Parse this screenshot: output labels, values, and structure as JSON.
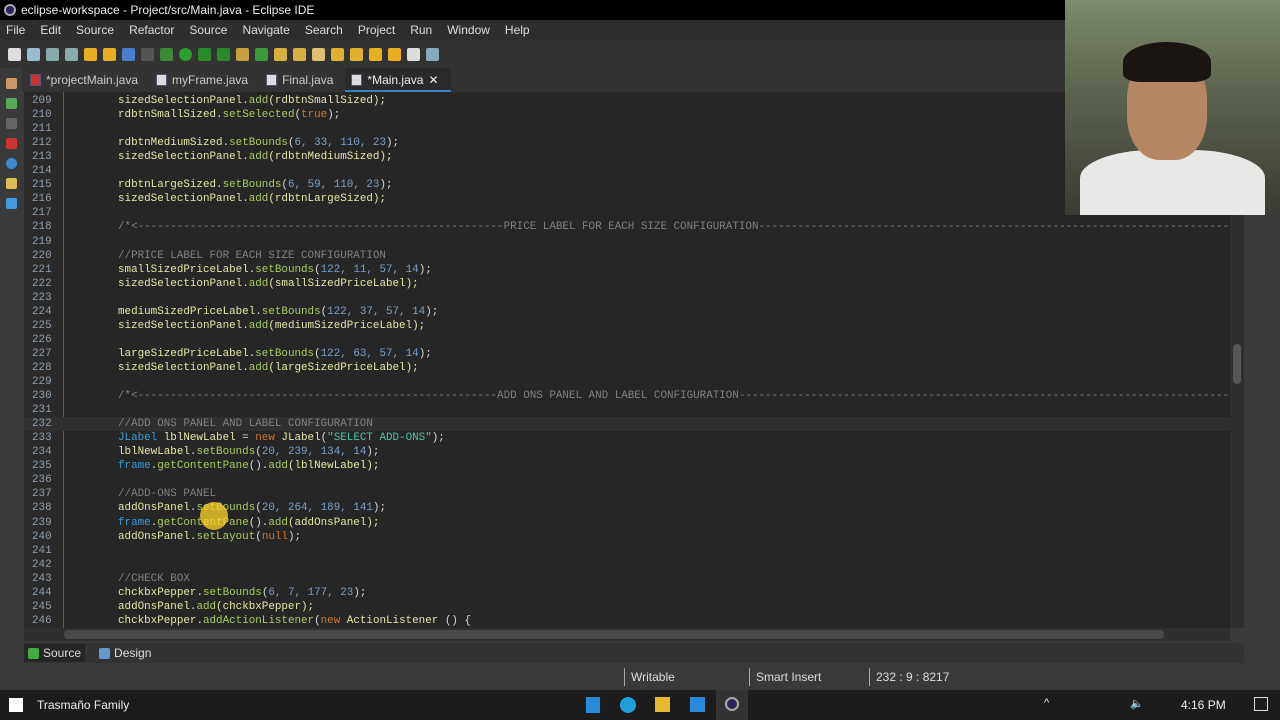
{
  "window": {
    "title": "eclipse-workspace - Project/src/Main.java - Eclipse IDE"
  },
  "menu": [
    "File",
    "Edit",
    "Source",
    "Refactor",
    "Source",
    "Navigate",
    "Search",
    "Project",
    "Run",
    "Window",
    "Help"
  ],
  "tabs": [
    {
      "label": "*projectMain.java"
    },
    {
      "label": "myFrame.java"
    },
    {
      "label": "Final.java"
    },
    {
      "label": "*Main.java",
      "close": "✕"
    }
  ],
  "editor": {
    "current_line": 232,
    "lines": [
      {
        "n": "209",
        "t": [
          [
            "sizedSelectionPanel",
            "id"
          ],
          [
            ".",
            "p"
          ],
          [
            "add",
            "m"
          ],
          [
            "(rdbtnSmallSized);",
            "id"
          ]
        ]
      },
      {
        "n": "210",
        "t": [
          [
            "rdbtnSmallSized",
            "id"
          ],
          [
            ".",
            "p"
          ],
          [
            "setSelected",
            "m"
          ],
          [
            "(",
            "p"
          ],
          [
            "true",
            "k"
          ],
          [
            ");",
            "p"
          ]
        ]
      },
      {
        "n": "211",
        "t": []
      },
      {
        "n": "212",
        "t": [
          [
            "rdbtnMediumSized",
            "id"
          ],
          [
            ".",
            "p"
          ],
          [
            "setBounds",
            "m"
          ],
          [
            "(",
            "p"
          ],
          [
            "6, 33, 110, 23",
            "n"
          ],
          [
            ");",
            "p"
          ]
        ]
      },
      {
        "n": "213",
        "t": [
          [
            "sizedSelectionPanel",
            "id"
          ],
          [
            ".",
            "p"
          ],
          [
            "add",
            "m"
          ],
          [
            "(rdbtnMediumSized);",
            "id"
          ]
        ]
      },
      {
        "n": "214",
        "t": []
      },
      {
        "n": "215",
        "t": [
          [
            "rdbtnLargeSized",
            "id"
          ],
          [
            ".",
            "p"
          ],
          [
            "setBounds",
            "m"
          ],
          [
            "(",
            "p"
          ],
          [
            "6, 59, 110, 23",
            "n"
          ],
          [
            ");",
            "p"
          ]
        ]
      },
      {
        "n": "216",
        "t": [
          [
            "sizedSelectionPanel",
            "id"
          ],
          [
            ".",
            "p"
          ],
          [
            "add",
            "m"
          ],
          [
            "(rdbtnLargeSized);",
            "id"
          ]
        ]
      },
      {
        "n": "217",
        "t": []
      },
      {
        "n": "218",
        "t": [
          [
            "/*<--------------------------------------------------------PRICE LABEL FOR EACH SIZE CONFIGURATION------------------------------------------------------------------------------",
            "c"
          ]
        ]
      },
      {
        "n": "219",
        "t": []
      },
      {
        "n": "220",
        "t": [
          [
            "//PRICE LABEL FOR EACH SIZE CONFIGURATION",
            "c"
          ]
        ]
      },
      {
        "n": "221",
        "t": [
          [
            "smallSizedPriceLabel",
            "id"
          ],
          [
            ".",
            "p"
          ],
          [
            "setBounds",
            "m"
          ],
          [
            "(",
            "p"
          ],
          [
            "122, 11, 57, 14",
            "n"
          ],
          [
            ");",
            "p"
          ]
        ]
      },
      {
        "n": "222",
        "t": [
          [
            "sizedSelectionPanel",
            "id"
          ],
          [
            ".",
            "p"
          ],
          [
            "add",
            "m"
          ],
          [
            "(smallSizedPriceLabel);",
            "id"
          ]
        ]
      },
      {
        "n": "223",
        "t": []
      },
      {
        "n": "224",
        "t": [
          [
            "mediumSizedPriceLabel",
            "id"
          ],
          [
            ".",
            "p"
          ],
          [
            "setBounds",
            "m"
          ],
          [
            "(",
            "p"
          ],
          [
            "122, 37, 57, 14",
            "n"
          ],
          [
            ");",
            "p"
          ]
        ]
      },
      {
        "n": "225",
        "t": [
          [
            "sizedSelectionPanel",
            "id"
          ],
          [
            ".",
            "p"
          ],
          [
            "add",
            "m"
          ],
          [
            "(mediumSizedPriceLabel);",
            "id"
          ]
        ]
      },
      {
        "n": "226",
        "t": []
      },
      {
        "n": "227",
        "t": [
          [
            "largeSizedPriceLabel",
            "id"
          ],
          [
            ".",
            "p"
          ],
          [
            "setBounds",
            "m"
          ],
          [
            "(",
            "p"
          ],
          [
            "122, 63, 57, 14",
            "n"
          ],
          [
            ");",
            "p"
          ]
        ]
      },
      {
        "n": "228",
        "t": [
          [
            "sizedSelectionPanel",
            "id"
          ],
          [
            ".",
            "p"
          ],
          [
            "add",
            "m"
          ],
          [
            "(largeSizedPriceLabel);",
            "id"
          ]
        ]
      },
      {
        "n": "229",
        "t": []
      },
      {
        "n": "230",
        "t": [
          [
            "/*<-------------------------------------------------------ADD ONS PANEL AND LABEL CONFIGURATION---------------------------------------------------------------------------------",
            "c"
          ]
        ]
      },
      {
        "n": "231",
        "t": []
      },
      {
        "n": "232",
        "t": [
          [
            "//ADD ONS PANEL AND LABEL CONFIGURATION",
            "c"
          ]
        ]
      },
      {
        "n": "233",
        "t": [
          [
            "JLabel ",
            "cl"
          ],
          [
            "lblNewLabel",
            "id"
          ],
          [
            " = ",
            "p"
          ],
          [
            "new ",
            "k"
          ],
          [
            "JLabel",
            "id"
          ],
          [
            "(",
            "p"
          ],
          [
            "\"SELECT ADD-ONS\"",
            "s"
          ],
          [
            ");",
            "p"
          ]
        ]
      },
      {
        "n": "234",
        "t": [
          [
            "lblNewLabel",
            "id"
          ],
          [
            ".",
            "p"
          ],
          [
            "setBounds",
            "m"
          ],
          [
            "(",
            "p"
          ],
          [
            "20, 239, 134, 14",
            "n"
          ],
          [
            ");",
            "p"
          ]
        ]
      },
      {
        "n": "235",
        "t": [
          [
            "frame",
            "cl"
          ],
          [
            ".",
            "p"
          ],
          [
            "getContentPane",
            "m"
          ],
          [
            "().",
            "p"
          ],
          [
            "add",
            "m"
          ],
          [
            "(lblNewLabel);",
            "id"
          ]
        ]
      },
      {
        "n": "236",
        "t": []
      },
      {
        "n": "237",
        "t": [
          [
            "//ADD-ONS PANEL",
            "c"
          ]
        ]
      },
      {
        "n": "238",
        "t": [
          [
            "addOnsPanel",
            "id"
          ],
          [
            ".",
            "p"
          ],
          [
            "setBounds",
            "m"
          ],
          [
            "(",
            "p"
          ],
          [
            "20, 264, 189, 141",
            "n"
          ],
          [
            ");",
            "p"
          ]
        ]
      },
      {
        "n": "239",
        "t": [
          [
            "frame",
            "cl"
          ],
          [
            ".",
            "p"
          ],
          [
            "getContentPane",
            "m"
          ],
          [
            "().",
            "p"
          ],
          [
            "add",
            "m"
          ],
          [
            "(addOnsPanel);",
            "id"
          ]
        ]
      },
      {
        "n": "240",
        "t": [
          [
            "addOnsPanel",
            "id"
          ],
          [
            ".",
            "p"
          ],
          [
            "setLayout",
            "m"
          ],
          [
            "(",
            "p"
          ],
          [
            "null",
            "k"
          ],
          [
            ");",
            "p"
          ]
        ]
      },
      {
        "n": "241",
        "t": []
      },
      {
        "n": "242",
        "t": []
      },
      {
        "n": "243",
        "t": [
          [
            "//CHECK BOX",
            "c"
          ]
        ]
      },
      {
        "n": "244",
        "t": [
          [
            "chckbxPepper",
            "id"
          ],
          [
            ".",
            "p"
          ],
          [
            "setBounds",
            "m"
          ],
          [
            "(",
            "p"
          ],
          [
            "6, 7, 177, 23",
            "n"
          ],
          [
            ");",
            "p"
          ]
        ]
      },
      {
        "n": "245",
        "t": [
          [
            "addOnsPanel",
            "id"
          ],
          [
            ".",
            "p"
          ],
          [
            "add",
            "m"
          ],
          [
            "(chckbxPepper);",
            "id"
          ]
        ]
      },
      {
        "n": "246",
        "t": [
          [
            "chckbxPepper",
            "id"
          ],
          [
            ".",
            "p"
          ],
          [
            "addActionListener",
            "m"
          ],
          [
            "(",
            "p"
          ],
          [
            "new ",
            "k"
          ],
          [
            "ActionListener",
            "id"
          ],
          [
            " () {",
            "p"
          ]
        ]
      }
    ]
  },
  "bottom_tabs": {
    "source": "Source",
    "design": "Design"
  },
  "status": {
    "writable": "Writable",
    "insert_mode": "Smart Insert",
    "position": "232 : 9 : 8217"
  },
  "taskbar": {
    "user": "Trasmaño Family",
    "time": "4:16 PM"
  }
}
